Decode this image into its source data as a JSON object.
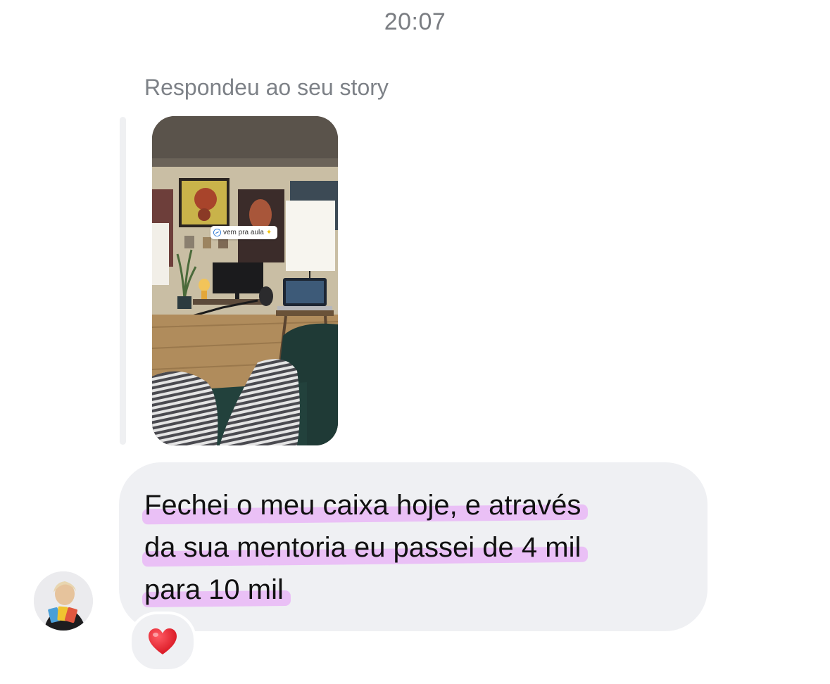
{
  "timestamp": "20:07",
  "reply": {
    "label": "Respondeu ao seu story",
    "story": {
      "sticker_text": "vem pra aula",
      "sticker_icons": [
        "link-icon",
        "sparkle-icon"
      ]
    }
  },
  "message": {
    "lines": [
      "Fechei o meu caixa hoje, e através",
      "da sua mentoria eu passei de 4 mil",
      "para 10 mil"
    ],
    "highlight_color": "#e9b7f6"
  },
  "reaction": {
    "icon": "heart-icon",
    "color": "#e4202d"
  },
  "colors": {
    "bubble": "#eff0f3",
    "secondary_text": "#7d8187"
  }
}
